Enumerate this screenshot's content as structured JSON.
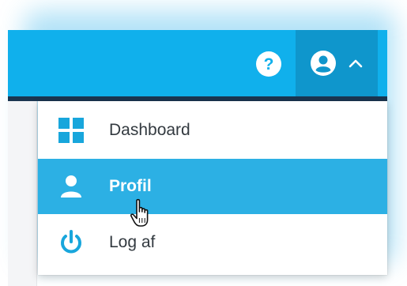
{
  "header": {
    "help_icon": "question-circle-icon",
    "user_icon": "user-circle-icon",
    "menu_open_icon": "chevron-up-icon",
    "background_color": "#10b0ec",
    "user_button_color": "#0f96cc"
  },
  "menu": {
    "items": [
      {
        "label": "Dashboard",
        "icon": "dashboard-grid-icon",
        "selected": false
      },
      {
        "label": "Profil",
        "icon": "user-icon",
        "selected": true
      },
      {
        "label": "Log af",
        "icon": "power-icon",
        "selected": false
      }
    ],
    "selected_color": "#2cb0e4",
    "icon_color": "#18a6dc"
  },
  "cursor": "hand-pointer"
}
